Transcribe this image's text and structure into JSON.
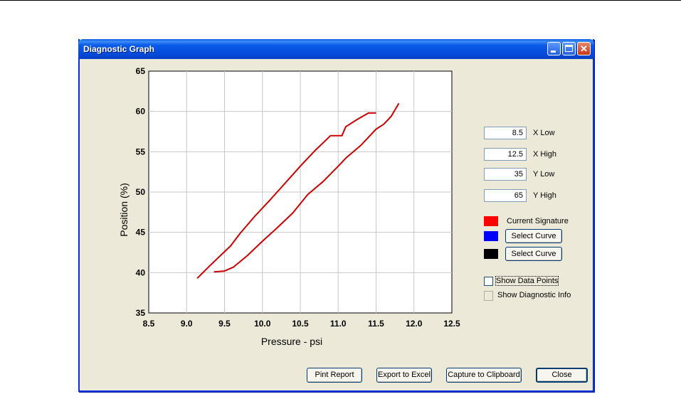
{
  "window": {
    "title": "Diagnostic Graph"
  },
  "controls": {
    "x_low": {
      "value": "8.5",
      "label": "X Low"
    },
    "x_high": {
      "value": "12.5",
      "label": "X High"
    },
    "y_low": {
      "value": "35",
      "label": "Y Low"
    },
    "y_high": {
      "value": "65",
      "label": "Y High"
    }
  },
  "legend": {
    "current": {
      "label": "Current Signature",
      "color": "#ff0000"
    },
    "blue": {
      "button": "Select Curve",
      "color": "#0000ff"
    },
    "black": {
      "button": "Select Curve",
      "color": "#000000"
    }
  },
  "options": {
    "show_data_points": {
      "label": "Show Data Points",
      "checked": false
    },
    "show_diag_info": {
      "label": "Show Diagnostic Info",
      "checked": false
    }
  },
  "buttons": {
    "print": "Pint Report",
    "export": "Export to Excel",
    "capture": "Capture to Clipboard",
    "close": "Close"
  },
  "chart_data": {
    "type": "line",
    "xlabel": "Pressure - psi",
    "ylabel": "Position (%)",
    "xlim": [
      8.5,
      12.5
    ],
    "ylim": [
      35,
      65
    ],
    "x_ticks": [
      "8.5",
      "9.0",
      "9.5",
      "10.0",
      "10.5",
      "11.0",
      "11.5",
      "12.0",
      "12.5"
    ],
    "y_ticks": [
      "35",
      "40",
      "45",
      "50",
      "55",
      "60",
      "65"
    ],
    "grid": true,
    "series": [
      {
        "color": "#cc0000",
        "x": [
          9.14,
          9.3,
          9.5,
          9.58,
          9.7,
          9.9,
          10.1,
          10.3,
          10.5,
          10.7,
          10.9,
          11.05,
          11.1,
          11.25,
          11.4,
          11.5
        ],
        "y": [
          39.3,
          40.8,
          42.6,
          43.3,
          44.8,
          47.0,
          49.0,
          51.1,
          53.2,
          55.2,
          57.0,
          57.0,
          58.1,
          59.0,
          59.8,
          59.8
        ]
      },
      {
        "color": "#cc0000",
        "x": [
          9.36,
          9.5,
          9.62,
          9.8,
          10.0,
          10.2,
          10.4,
          10.6,
          10.8,
          11.0,
          11.1,
          11.3,
          11.5,
          11.6,
          11.7,
          11.8
        ],
        "y": [
          40.1,
          40.2,
          40.7,
          42.1,
          43.9,
          45.6,
          47.4,
          49.7,
          51.3,
          53.2,
          54.2,
          55.8,
          57.8,
          58.4,
          59.4,
          61.0
        ]
      }
    ]
  }
}
